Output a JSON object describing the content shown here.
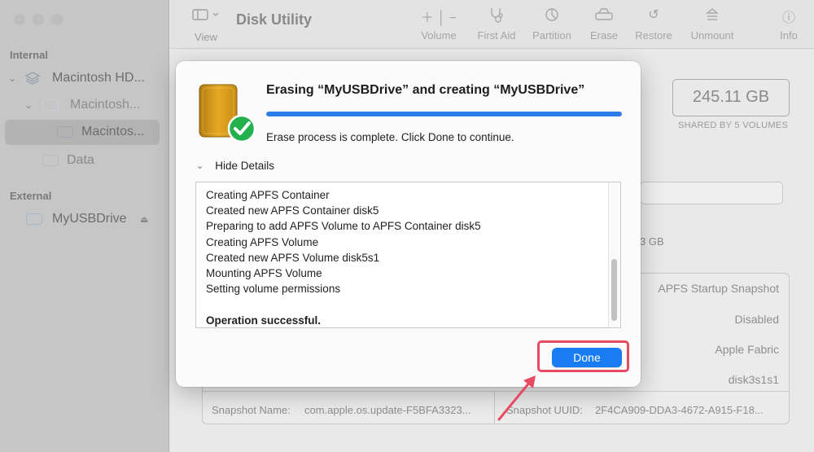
{
  "app": {
    "title": "Disk Utility"
  },
  "sidebar": {
    "section_internal": "Internal",
    "section_external": "External",
    "items": [
      {
        "label": "Macintosh HD..."
      },
      {
        "label": "Macintosh..."
      },
      {
        "label": "Macintos..."
      },
      {
        "label": "Data"
      },
      {
        "label": "MyUSBDrive"
      }
    ]
  },
  "toolbar": {
    "view_label": "View",
    "buttons": [
      {
        "label": "Volume"
      },
      {
        "label": "First Aid"
      },
      {
        "label": "Partition"
      },
      {
        "label": "Erase"
      },
      {
        "label": "Restore"
      },
      {
        "label": "Unmount"
      },
      {
        "label": "Info"
      }
    ]
  },
  "main": {
    "capacity": "245.11 GB",
    "shared": "SHARED BY 5 VOLUMES",
    "size_partial": "3 GB",
    "rows_right": [
      "APFS Startup Snapshot",
      "Disabled",
      "Apple Fabric",
      "disk3s1s1"
    ],
    "snapshot_name_label": "Snapshot Name:",
    "snapshot_name_value": "com.apple.os.update-F5BFA3323...",
    "snapshot_uuid_label": "Snapshot UUID:",
    "snapshot_uuid_value": "2F4CA909-DDA3-4672-A915-F18..."
  },
  "dialog": {
    "title": "Erasing “MyUSBDrive” and creating “MyUSBDrive”",
    "progress": 1.0,
    "status": "Erase process is complete. Click Done to continue.",
    "details_toggle": "Hide Details",
    "log": [
      "Creating APFS Container",
      "Created new APFS Container disk5",
      "Preparing to add APFS Volume to APFS Container disk5",
      "Creating APFS Volume",
      "Created new APFS Volume disk5s1",
      "Mounting APFS Volume",
      "Setting volume permissions",
      "",
      "Operation successful."
    ],
    "done_label": "Done"
  },
  "colors": {
    "accent": "#1a7cf2",
    "highlight": "#e64b62",
    "check": "#22b14c"
  }
}
